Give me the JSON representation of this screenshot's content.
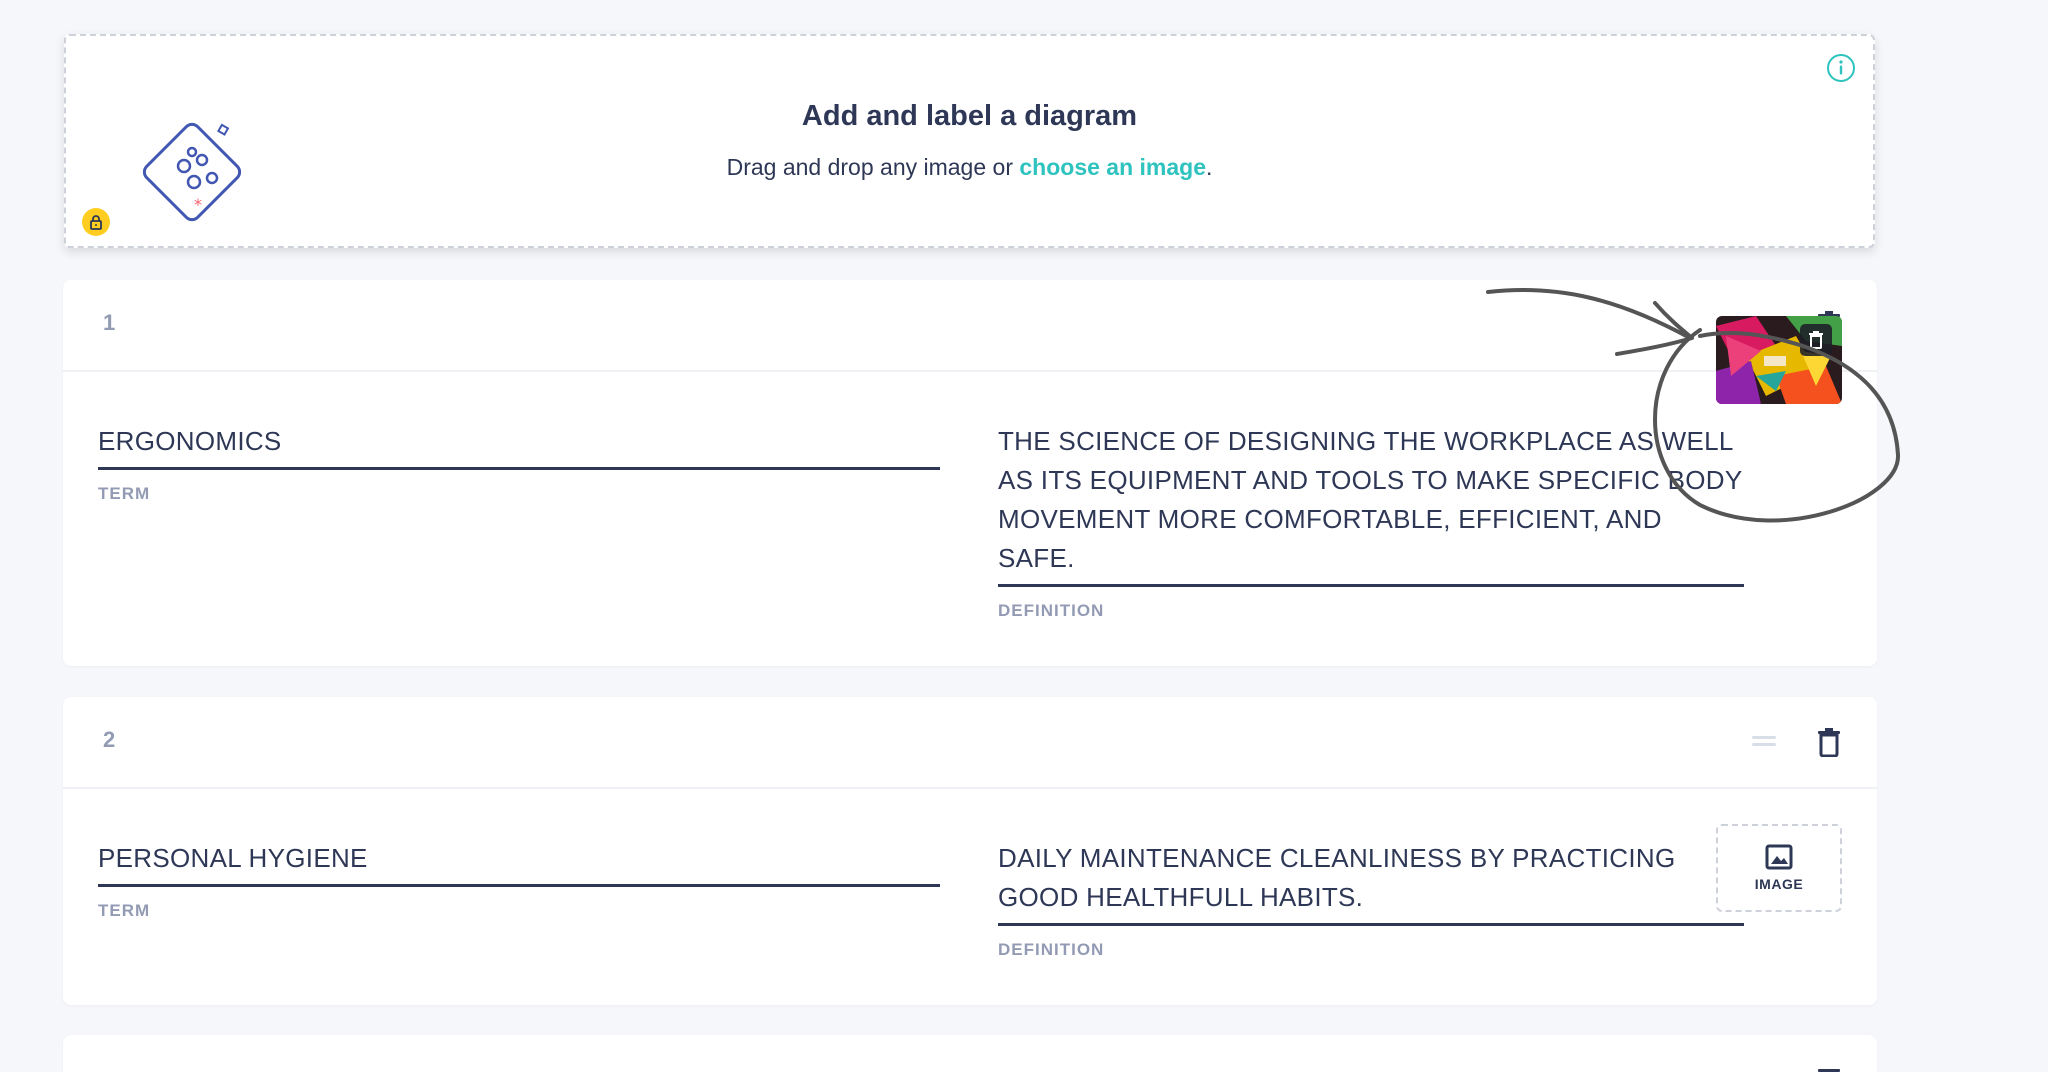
{
  "diagram": {
    "title": "Add and label a diagram",
    "subtitle_prefix": "Drag and drop any image or ",
    "subtitle_link": "choose an image",
    "subtitle_suffix": ".",
    "accent_color": "#2ec3be",
    "lock_color": "#ffcd1f"
  },
  "cards": [
    {
      "number": "1",
      "term": "ERGONOMICS",
      "term_label": "TERM",
      "definition": "THE SCIENCE OF DESIGNING THE WORKPLACE AS WELL AS ITS EQUIPMENT AND TOOLS TO MAKE SPECIFIC BODY MOVEMENT MORE COMFORTABLE, EFFICIENT, AND SAFE.",
      "definition_label": "DEFINITION",
      "has_image": true
    },
    {
      "number": "2",
      "term": "PERSONAL HYGIENE",
      "term_label": "TERM",
      "definition": "DAILY MAINTENANCE CLEANLINESS BY PRACTICING GOOD HEALTHFULL HABITS.",
      "definition_label": "DEFINITION",
      "has_image": false,
      "image_button_label": "IMAGE"
    }
  ],
  "icons": {
    "drag": "drag-handle-icon",
    "delete": "trash-icon",
    "info": "info-icon",
    "lock": "lock-icon",
    "image": "image-icon"
  }
}
